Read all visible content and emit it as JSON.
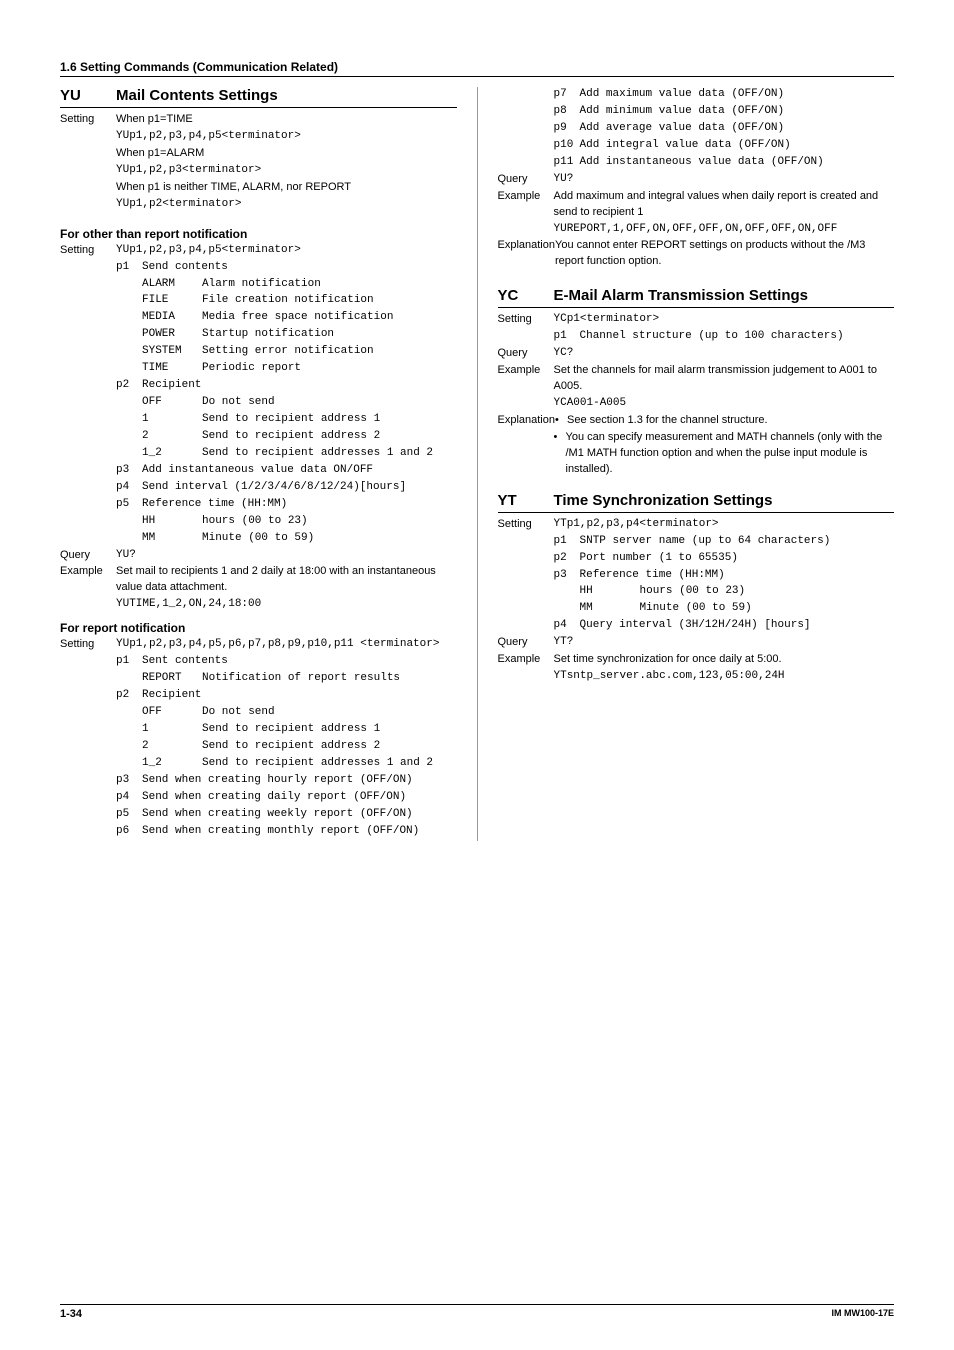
{
  "header": {
    "section": "1.6  Setting Commands (Communication Related)"
  },
  "left": {
    "yu": {
      "code": "YU",
      "title": "Mail Contents Settings",
      "setting_label": "Setting",
      "s1": "When p1=TIME",
      "s1s": "YUp1,p2,p3,p4,p5<terminator>",
      "s2": "When p1=ALARM",
      "s2s": "YUp1,p2,p3<terminator>",
      "s3": "When p1 is neither TIME, ALARM, nor REPORT",
      "s3s": "YUp1,p2<terminator>"
    },
    "other": {
      "head": "For other than report notification",
      "setting_label": "Setting",
      "syntax": "YUp1,p2,p3,p4,p5<terminator>",
      "p1h": "Send contents",
      "p1": [
        [
          "ALARM",
          "Alarm notification"
        ],
        [
          "FILE",
          "File creation notification"
        ],
        [
          "MEDIA",
          "Media free space notification"
        ],
        [
          "POWER",
          "Startup notification"
        ],
        [
          "SYSTEM",
          "Setting error notification"
        ],
        [
          "TIME",
          "Periodic report"
        ]
      ],
      "p2h": "Recipient",
      "p2": [
        [
          "OFF",
          "Do not send"
        ],
        [
          "1",
          "Send to recipient address 1"
        ],
        [
          "2",
          "Send to recipient address 2"
        ],
        [
          "1_2",
          "Send to recipient addresses 1 and 2"
        ]
      ],
      "p3": "Add instantaneous value data ON/OFF",
      "p4": "Send interval (1/2/3/4/6/8/12/24)[hours]",
      "p5": "Reference time (HH:MM)",
      "p5s": [
        [
          "HH",
          "hours (00 to 23)"
        ],
        [
          "MM",
          "Minute (00 to 59)"
        ]
      ],
      "query_label": "Query",
      "query": "YU?",
      "example_label": "Example",
      "example_t": "Set mail to recipients 1 and 2 daily at 18:00 with an instantaneous value data attachment.",
      "example_c": "YUTIME,1_2,ON,24,18:00"
    },
    "report": {
      "head": "For report notification",
      "setting_label": "Setting",
      "syntax": "YUp1,p2,p3,p4,p5,p6,p7,p8,p9,p10,p11 <terminator>",
      "p1h": "Sent contents",
      "p1": [
        [
          "REPORT",
          "Notification of report results"
        ]
      ],
      "p2h": "Recipient",
      "p2": [
        [
          "OFF",
          "Do not send"
        ],
        [
          "1",
          "Send to recipient address 1"
        ],
        [
          "2",
          "Send to recipient address 2"
        ],
        [
          "1_2",
          "Send to recipient addresses 1 and 2"
        ]
      ],
      "p3": "Send when creating hourly report (OFF/ON)",
      "p4": "Send when creating daily report (OFF/ON)",
      "p5": "Send when creating weekly report (OFF/ON)",
      "p6": "Send when creating monthly report (OFF/ON)"
    }
  },
  "right": {
    "cont": {
      "p7": "Add maximum value data (OFF/ON)",
      "p8": "Add minimum value data (OFF/ON)",
      "p9": "Add average value data (OFF/ON)",
      "p10": "Add integral value data (OFF/ON)",
      "p11": "Add instantaneous value data (OFF/ON)",
      "query_label": "Query",
      "query": "YU?",
      "example_label": "Example",
      "example_t": "Add maximum and integral values when daily report is created and send to recipient 1",
      "example_c": "YUREPORT,1,OFF,ON,OFF,OFF,ON,OFF,OFF,ON,OFF",
      "expl_label": "Explanation",
      "expl": "You cannot enter REPORT settings on products without the /M3 report function option."
    },
    "yc": {
      "code": "YC",
      "title": "E-Mail Alarm Transmission Settings",
      "setting_label": "Setting",
      "syntax": "YCp1<terminator>",
      "p1": "Channel structure (up to 100 characters)",
      "query_label": "Query",
      "query": "YC?",
      "example_label": "Example",
      "example_t": "Set the channels for mail alarm transmission judgement to A001 to A005.",
      "example_c": "YCA001-A005",
      "expl_label": "Explanation",
      "b1": "See section 1.3 for the channel structure.",
      "b2": "You can specify measurement and MATH channels (only with the /M1 MATH function option and when the pulse input module is installed)."
    },
    "yt": {
      "code": "YT",
      "title": "Time Synchronization Settings",
      "setting_label": "Setting",
      "syntax": "YTp1,p2,p3,p4<terminator>",
      "p1": "SNTP server name (up to 64 characters)",
      "p2": "Port number (1 to 65535)",
      "p3": "Reference time (HH:MM)",
      "p3s": [
        [
          "HH",
          "hours (00 to 23)"
        ],
        [
          "MM",
          "Minute (00 to 59)"
        ]
      ],
      "p4": "Query interval (3H/12H/24H) [hours]",
      "query_label": "Query",
      "query": "YT?",
      "example_label": "Example",
      "example_t": "Set time synchronization for once daily at 5:00.",
      "example_c": "YTsntp_server.abc.com,123,05:00,24H"
    }
  },
  "footer": {
    "page": "1-34",
    "doc": "IM MW100-17E"
  }
}
